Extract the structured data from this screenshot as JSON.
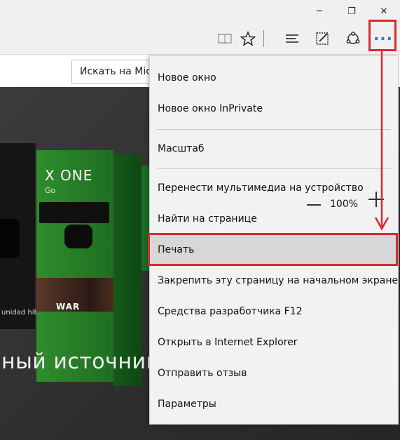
{
  "window": {
    "minimize_glyph": "─",
    "maximize_glyph": "❐",
    "close_glyph": "✕"
  },
  "toolbar": {
    "icons": [
      "reading-view-icon",
      "favorite-star-icon",
      "hub-icon",
      "web-note-icon",
      "share-icon",
      "more-icon"
    ],
    "more_glyph": "..."
  },
  "page": {
    "search_placeholder": "Искать на Micr",
    "hero_heading": "ный источник р",
    "xbox_brand": "X ONE",
    "xbox_sub": "Go",
    "box_caption": "unidad híbrida",
    "game_title": "WAR"
  },
  "menu": {
    "items": [
      {
        "label": "Новое окно"
      },
      {
        "label": "Новое окно InPrivate"
      },
      {
        "label": "Масштаб"
      },
      {
        "label": "Перенести мультимедиа на устройство"
      },
      {
        "label": "Найти на странице"
      },
      {
        "label": "Печать"
      },
      {
        "label": "Закрепить эту страницу на начальном экране"
      },
      {
        "label": "Средства разработчика F12"
      },
      {
        "label": "Открыть в Internet Explorer"
      },
      {
        "label": "Отправить отзыв"
      },
      {
        "label": "Параметры"
      }
    ],
    "zoom_value": "100%"
  },
  "colors": {
    "highlight": "#d52b33",
    "accent_more": "#1c7fd6",
    "menu_bg": "#f2f2f2",
    "selected_bg": "#d7d7d7"
  }
}
